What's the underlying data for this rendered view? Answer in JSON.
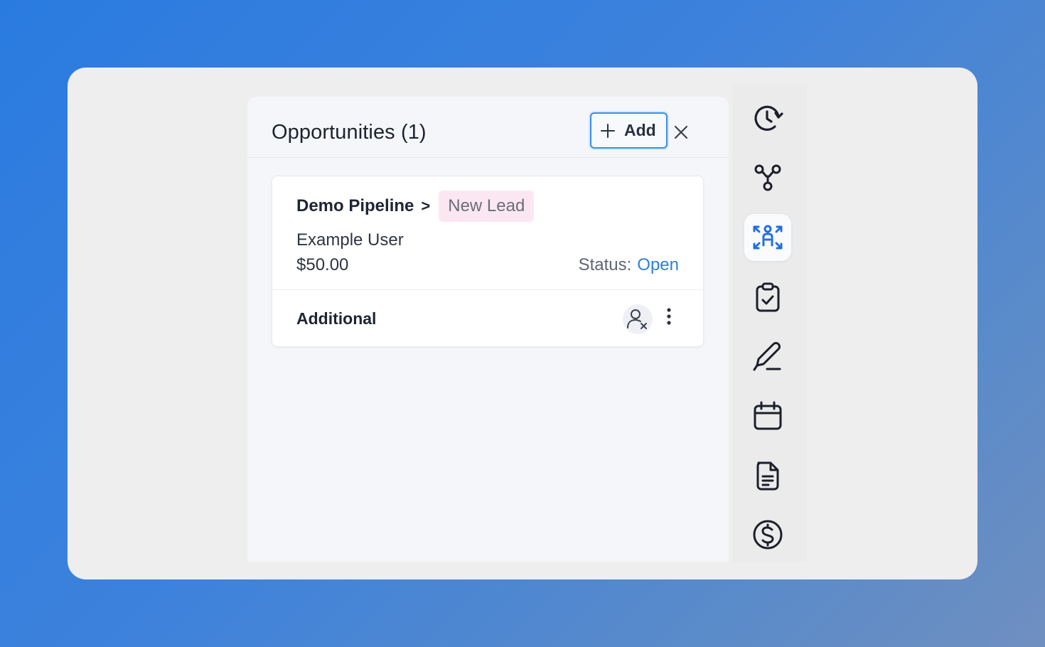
{
  "panel": {
    "title": "Opportunities (1)",
    "add_label": "Add",
    "close_icon": "close-icon"
  },
  "opportunity": {
    "pipeline": "Demo Pipeline",
    "separator": ">",
    "stage": "New Lead",
    "contact": "Example User",
    "amount": "$50.00",
    "status_label": "Status:",
    "status_value": "Open",
    "section_label": "Additional"
  },
  "rail": {
    "items": [
      {
        "icon": "history-icon",
        "active": false
      },
      {
        "icon": "workflow-icon",
        "active": false
      },
      {
        "icon": "opportunities-icon",
        "active": true
      },
      {
        "icon": "tasks-icon",
        "active": false
      },
      {
        "icon": "notes-icon",
        "active": false
      },
      {
        "icon": "calendar-icon",
        "active": false
      },
      {
        "icon": "documents-icon",
        "active": false
      },
      {
        "icon": "payments-icon",
        "active": false
      }
    ]
  },
  "colors": {
    "accent": "#2f7fd8",
    "stage_badge_bg": "#fbe7f2",
    "active_rail_icon": "#1f6fe0"
  }
}
